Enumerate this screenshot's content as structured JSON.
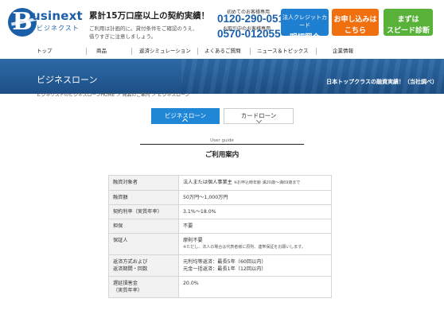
{
  "header": {
    "logo_main": "usinext",
    "logo_letter": "B",
    "logo_sub": "ビジネクスト",
    "tagline_title": "累計15万口座以上の契約実績！",
    "tagline_note1": "ご利用は計画的に。貸付条件をご確認のうえ、",
    "tagline_note2": "借りすぎに注意しましょう。",
    "phone1_label": "初めてのお客様専用",
    "phone1": "0120-290-051",
    "phone2_label": "お取引中のお客様専用",
    "phone2": "0570-012055",
    "btn_card_line1": "法人クレジットカード",
    "btn_card_line2": "明細照会",
    "btn_apply_line1": "お申し込みは",
    "btn_apply_line2": "こちら",
    "btn_diag_line1": "まずは",
    "btn_diag_line2": "スピード診断"
  },
  "nav": [
    "トップ",
    "商品",
    "返済シミュレーション",
    "よくあるご質問",
    "ニュース＆トピックス",
    "企業情報"
  ],
  "banner": {
    "title": "ビジネスローン",
    "tag": "日本トップクラスの融資実績！（当社調べ）"
  },
  "breadcrumb": "ビジネクストのビジネスローンHOME ＞ 商品のご案内 ＞ ビジネスローン",
  "tabs": {
    "active": "ビジネスローン",
    "inactive": "カードローン"
  },
  "guide": {
    "en": "User guide",
    "title": "ご利用案内"
  },
  "table": {
    "rows": [
      {
        "label": "融資対象者",
        "value": "法人または個人事業主",
        "note": "※お申込時年齢 満20歳〜満69歳まで"
      },
      {
        "label": "融資額",
        "value": "50万円〜1,000万円"
      },
      {
        "label": "契約利率（実質年率）",
        "value": "3.1%〜18.0%"
      },
      {
        "label": "担保",
        "value": "不要"
      },
      {
        "label": "保証人",
        "value": "原則不要",
        "value2": "※ただし、法人の場合は代表者様に原則、連帯保証をお願いします。"
      },
      {
        "label": "返済方式および",
        "label2": "返済期間・回数",
        "value": "元利均等返済：最長5年（60回以内）",
        "value2": "元金一括返済：最長1年（12回以内）"
      },
      {
        "label": "遅延損害金",
        "label2": "（実質年率）",
        "value": "20.0%"
      }
    ]
  }
}
